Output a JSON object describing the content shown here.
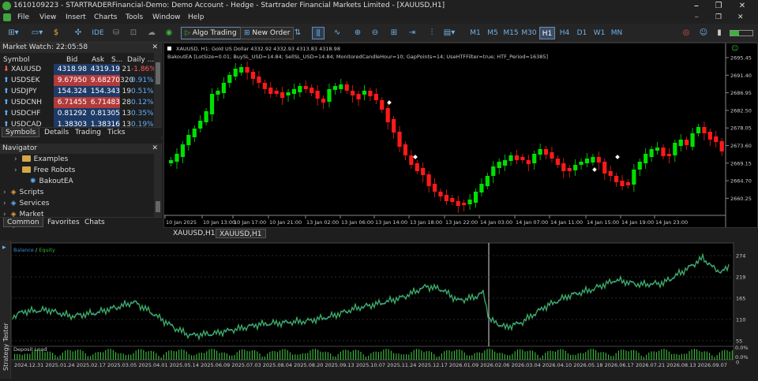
{
  "window": {
    "title": "1610109223 - STARTRADERFinancial-Demo: Demo Account - Hedge - Startrader Financial Markets Limited - [XAUUSD,H1]",
    "controls": [
      "⎯",
      "❐",
      "✕"
    ],
    "mdi_controls": [
      "⎯",
      "❐",
      "✕"
    ]
  },
  "menu": [
    "File",
    "View",
    "Insert",
    "Charts",
    "Tools",
    "Window",
    "Help"
  ],
  "toolbar": {
    "ide_label": "IDE",
    "algo_trading_label": "Algo Trading",
    "new_order_label": "New Order",
    "timeframes": [
      "M1",
      "M5",
      "M15",
      "M30",
      "H1",
      "H4",
      "D1",
      "W1",
      "MN"
    ],
    "active_timeframe": "H1"
  },
  "market_watch": {
    "title": "Market Watch: 22:05:58",
    "columns": [
      "Symbol",
      "Bid",
      "Ask",
      "S...",
      "Daily ..."
    ],
    "rows": [
      {
        "symbol": "XAUUSD",
        "bid": "4318.98",
        "ask": "4319.19",
        "spread": "21",
        "daily": "-1.86%",
        "bid_color": "#1e3a66",
        "ask_color": "#1e3a66",
        "daily_color": "#ff5a5a"
      },
      {
        "symbol": "USDSEK",
        "bid": "9.67950",
        "ask": "9.68270",
        "spread": "320",
        "daily": "0.91%",
        "bid_color": "#b33a3a",
        "ask_color": "#b33a3a",
        "daily_color": "#5ab0ff"
      },
      {
        "symbol": "USDJPY",
        "bid": "154.324",
        "ask": "154.343",
        "spread": "19",
        "daily": "0.51%",
        "bid_color": "#1e3a66",
        "ask_color": "#1e3a66",
        "daily_color": "#5ab0ff"
      },
      {
        "symbol": "USDCNH",
        "bid": "6.71455",
        "ask": "6.71483",
        "spread": "28",
        "daily": "0.12%",
        "bid_color": "#b33a3a",
        "ask_color": "#b33a3a",
        "daily_color": "#5ab0ff"
      },
      {
        "symbol": "USDCHF",
        "bid": "0.81292",
        "ask": "0.81305",
        "spread": "13",
        "daily": "0.35%",
        "bid_color": "#1e3a66",
        "ask_color": "#1e3a66",
        "daily_color": "#5ab0ff"
      },
      {
        "symbol": "USDCAD",
        "bid": "1.38303",
        "ask": "1.38316",
        "spread": "13",
        "daily": "0.19%",
        "bid_color": "#1e3a66",
        "ask_color": "#1e3a66",
        "daily_color": "#5ab0ff"
      }
    ],
    "tabs": [
      "Symbols",
      "Details",
      "Trading",
      "Ticks"
    ],
    "active_tab": "Symbols"
  },
  "navigator": {
    "title": "Navigator",
    "items": [
      {
        "label": "Examples",
        "type": "folder",
        "indent": 1
      },
      {
        "label": "Free Robots",
        "type": "folder",
        "indent": 1
      },
      {
        "label": "BakoutEA",
        "type": "ea",
        "indent": 2
      },
      {
        "label": "Scripts",
        "type": "folder-top",
        "indent": 0
      },
      {
        "label": "Services",
        "type": "folder-top",
        "indent": 0
      },
      {
        "label": "Market",
        "type": "folder-top",
        "indent": 0
      },
      {
        "label": "VPS",
        "type": "folder-top",
        "indent": 0
      }
    ],
    "tabs": [
      "Common",
      "Favorites",
      "Chats"
    ],
    "active_tab": "Common"
  },
  "chart": {
    "header": "XAUUSD, H1:  Gold US Dollar  4332.92 4332.93 4313.83 4318.98",
    "ea_params": "BakoutEA [LotSize=0.01; BuySL_USD=14.84; SellSL_USD=14.84; MonitoredCandleHour=10; GapPoints=14; UseHTFFilter=true; HTF_Period=16385]",
    "price_labels": [
      "2695.45",
      "2691.40",
      "2686.95",
      "2682.50",
      "2678.05",
      "2673.60",
      "2669.15",
      "2664.70",
      "2660.25"
    ],
    "time_labels": [
      "10 Jan 2025",
      "10 Jan 13:00",
      "10 Jan 17:00",
      "10 Jan 21:00",
      "13 Jan 02:00",
      "13 Jan 06:00",
      "13 Jan 14:00",
      "13 Jan 18:00",
      "13 Jan 22:00",
      "14 Jan 03:00",
      "14 Jan 07:00",
      "14 Jan 11:00",
      "14 Jan 15:00",
      "14 Jan 19:00",
      "14 Jan 23:00"
    ],
    "bull_color": "#00e000",
    "bear_color": "#ff1a1a"
  },
  "chart_tabs": [
    "XAUUSD,H1",
    "XAUUSD,H1"
  ],
  "tester": {
    "side_label": "Strategy Tester",
    "legend_balance": "Balance",
    "legend_sep": " / ",
    "legend_equity": "Equity",
    "y_labels": [
      "274",
      "219",
      "165",
      "110",
      "55",
      "0"
    ],
    "deposit_load_label": "Deposit Load",
    "deposit_y_labels": [
      "0.0%",
      "0.0%"
    ],
    "date_labels": [
      "2024.12.31",
      "2025.01.24",
      "2025.02.17",
      "2025.03.05",
      "2025.04.01",
      "2025.05.14",
      "2025.06.09",
      "2025.07.03",
      "2025.08.04",
      "2025.08.20",
      "2025.09.13",
      "2025.10.07",
      "2025.11.24",
      "2025.12.17",
      "2026.01.09",
      "2026.02.06",
      "2026.03.04",
      "2026.04.10",
      "2026.05.18",
      "2026.06.17",
      "2026.07.21",
      "2026.08.13",
      "2026.09.07"
    ],
    "balance_color": "#3b8fd8",
    "equity_color": "#3cb43c"
  }
}
